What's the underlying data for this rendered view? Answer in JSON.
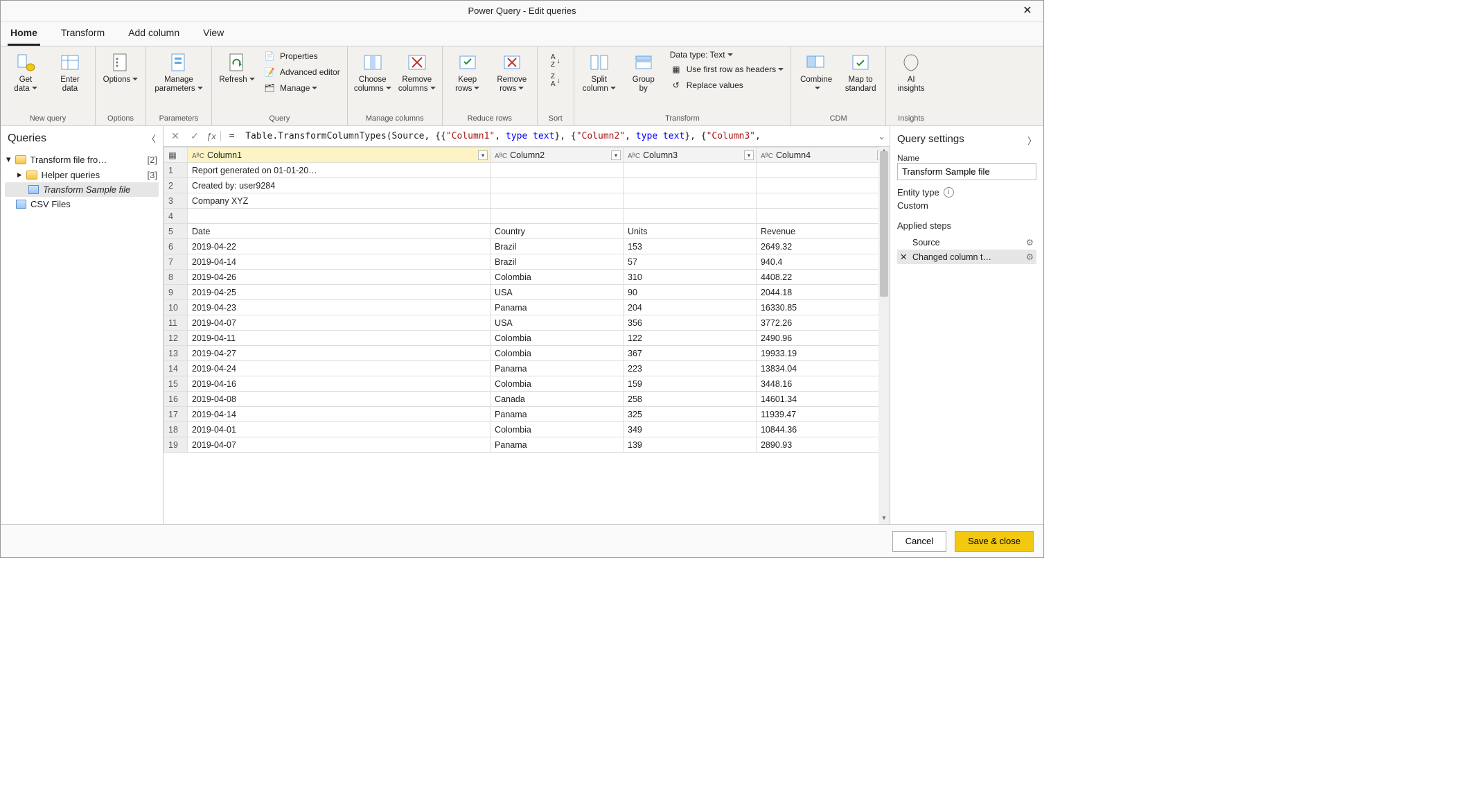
{
  "window": {
    "title": "Power Query - Edit queries"
  },
  "tabs": {
    "home": "Home",
    "transform": "Transform",
    "addcol": "Add column",
    "view": "View"
  },
  "ribbon": {
    "newquery": {
      "getdata": "Get\ndata",
      "enterdata": "Enter\ndata",
      "label": "New query"
    },
    "options": {
      "options": "Options",
      "label": "Options"
    },
    "parameters": {
      "manage": "Manage\nparameters",
      "label": "Parameters"
    },
    "query": {
      "refresh": "Refresh",
      "properties": "Properties",
      "advanced": "Advanced editor",
      "manage": "Manage",
      "label": "Query"
    },
    "managecols": {
      "choose": "Choose\ncolumns",
      "remove": "Remove\ncolumns",
      "label": "Manage columns"
    },
    "reducerows": {
      "keep": "Keep\nrows",
      "remove": "Remove\nrows",
      "label": "Reduce rows"
    },
    "sort": {
      "label": "Sort"
    },
    "transform": {
      "split": "Split\ncolumn",
      "groupby": "Group\nby",
      "datatype": "Data type: Text",
      "firstrow": "Use first row as headers",
      "replace": "Replace values",
      "label": "Transform"
    },
    "cdm": {
      "combine": "Combine",
      "map": "Map to\nstandard",
      "label": "CDM"
    },
    "insights": {
      "ai": "AI\ninsights",
      "label": "Insights"
    }
  },
  "queries": {
    "title": "Queries",
    "items": [
      {
        "label": "Transform file fro…",
        "count": "[2]"
      },
      {
        "label": "Helper queries",
        "count": "[3]"
      },
      {
        "label": "Transform Sample file"
      },
      {
        "label": "CSV Files"
      }
    ]
  },
  "formula": {
    "eq": "=",
    "p1": "Table.TransformColumnTypes(Source, {{",
    "s1": "\"Column1\"",
    "p2": ", ",
    "k1": "type text",
    "p3": "}, {",
    "s2": "\"Column2\"",
    "k2": "type text",
    "p4": "}, {",
    "s3": "\"Column3\"",
    "p5": ","
  },
  "grid": {
    "headers": [
      "Column1",
      "Column2",
      "Column3",
      "Column4"
    ],
    "type_prefix": "AᴮC",
    "rows": [
      [
        "Report generated on 01-01-20…",
        "",
        "",
        ""
      ],
      [
        "Created by: user9284",
        "",
        "",
        ""
      ],
      [
        "Company XYZ",
        "",
        "",
        ""
      ],
      [
        "",
        "",
        "",
        ""
      ],
      [
        "Date",
        "Country",
        "Units",
        "Revenue"
      ],
      [
        "2019-04-22",
        "Brazil",
        "153",
        "2649.32"
      ],
      [
        "2019-04-14",
        "Brazil",
        "57",
        "940.4"
      ],
      [
        "2019-04-26",
        "Colombia",
        "310",
        "4408.22"
      ],
      [
        "2019-04-25",
        "USA",
        "90",
        "2044.18"
      ],
      [
        "2019-04-23",
        "Panama",
        "204",
        "16330.85"
      ],
      [
        "2019-04-07",
        "USA",
        "356",
        "3772.26"
      ],
      [
        "2019-04-11",
        "Colombia",
        "122",
        "2490.96"
      ],
      [
        "2019-04-27",
        "Colombia",
        "367",
        "19933.19"
      ],
      [
        "2019-04-24",
        "Panama",
        "223",
        "13834.04"
      ],
      [
        "2019-04-16",
        "Colombia",
        "159",
        "3448.16"
      ],
      [
        "2019-04-08",
        "Canada",
        "258",
        "14601.34"
      ],
      [
        "2019-04-14",
        "Panama",
        "325",
        "11939.47"
      ],
      [
        "2019-04-01",
        "Colombia",
        "349",
        "10844.36"
      ],
      [
        "2019-04-07",
        "Panama",
        "139",
        "2890.93"
      ]
    ]
  },
  "settings": {
    "title": "Query settings",
    "name_label": "Name",
    "name_value": "Transform Sample file",
    "entity_label": "Entity type",
    "entity_value": "Custom",
    "steps_label": "Applied steps",
    "steps": [
      "Source",
      "Changed column t…"
    ]
  },
  "footer": {
    "cancel": "Cancel",
    "save": "Save & close"
  }
}
